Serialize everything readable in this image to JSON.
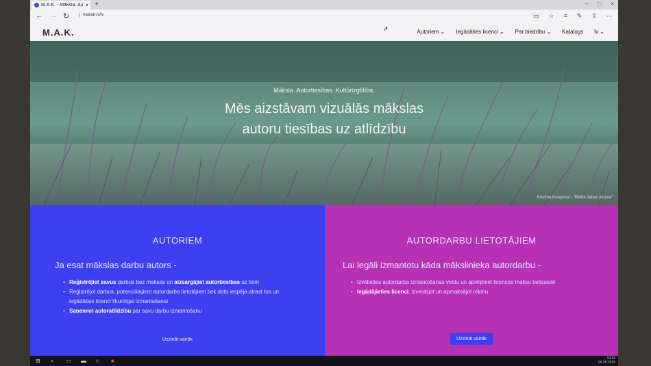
{
  "browser": {
    "tab_title": "M.A.K. - Māksla. Autortie",
    "tab_close": "×",
    "new_tab": "+",
    "url": "makart.lv/lv",
    "window_controls": [
      "–",
      "□",
      "×"
    ]
  },
  "site": {
    "logo": "M.A.K.",
    "menu": [
      {
        "label": "Autoriem ⌄"
      },
      {
        "label": "Iegādāties licenci ⌄"
      },
      {
        "label": "Par biedrību ⌄"
      },
      {
        "label": "Katalogs"
      },
      {
        "label": "lv ⌄"
      }
    ]
  },
  "hero": {
    "kicker": "Māksla. Autortiesības. Kultūrizglītība.",
    "title_line1": "Mēs aizstāvam vizuālās mākslas",
    "title_line2": "autoru tiesības uz atlīdzību",
    "credit": "Kristīne Kutepova - \"Bēdīā dabas ainava\""
  },
  "panels": {
    "left": {
      "title": "AUTORIEM",
      "subtitle": "Ja esat mākslas darbu autors -",
      "items": [
        {
          "b1": "Reģistrējiet savus",
          "t1": " darbus bez maksas un ",
          "b2": "aizsargājiet autortiesības",
          "t2": " uz tiem"
        },
        {
          "t1": "Reģistrējot darbus, potenciālajiem autordarba lietotājiem tiek dota iespēja atrast tos un iegādāties licenci likumīgai izmantošanai"
        },
        {
          "b1": "Saņemiet autoratlīdzību",
          "t1": " par savu darbu izmantošanu"
        }
      ],
      "button": "Uzzināt vairāk"
    },
    "right": {
      "title": "AUTORDARBU LIETOTĀJIEM",
      "subtitle": "Lai legāli izmantotu kāda mākslinieka autordarbu -",
      "items": [
        {
          "t1": "Izvēlieties autordarba izmantošanas veidu un aprēķiniet licences maksu tiešsaistē"
        },
        {
          "b1": "Iegādājieties licenci",
          "t1": ", izveidojot un apmaksājot rēķinu"
        }
      ],
      "button": "Uzzināt vairāk"
    }
  },
  "taskbar": {
    "time": "19:16",
    "date": "06.05.2019"
  },
  "colors": {
    "left_panel": "#3f3ff2",
    "right_panel": "#b631b5",
    "hero": "#4b6a60"
  }
}
